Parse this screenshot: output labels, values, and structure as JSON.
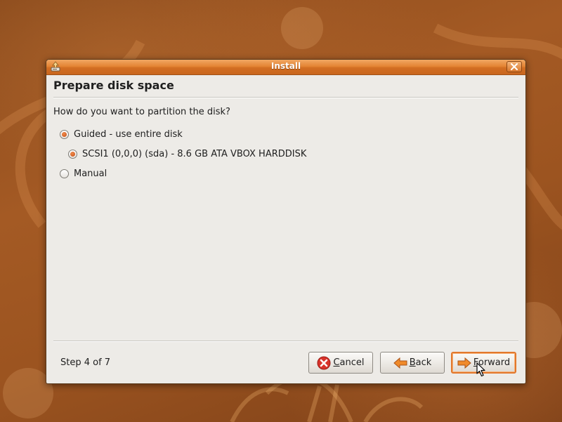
{
  "window": {
    "title": "Install"
  },
  "page": {
    "heading": "Prepare disk space",
    "question": "How do you want to partition the disk?"
  },
  "options": {
    "guided": {
      "label": "Guided - use entire disk",
      "checked": true
    },
    "disk": {
      "label": "SCSI1 (0,0,0) (sda) - 8.6 GB ATA VBOX HARDDISK",
      "checked": true
    },
    "manual": {
      "label": "Manual",
      "checked": false
    }
  },
  "footer": {
    "step": "Step 4 of 7",
    "cancel": {
      "mnemonic": "C",
      "rest": "ancel"
    },
    "back": {
      "mnemonic": "B",
      "rest": "ack"
    },
    "forward": {
      "mnemonic": "F",
      "rest": "orward"
    }
  },
  "colors": {
    "accent": "#e48434",
    "cancel_icon": "#d8322a",
    "arrow_icon": "#f08a2a"
  },
  "icons": {
    "app": "installer-icon",
    "close": "close-icon",
    "cancel": "cancel-icon",
    "back": "arrow-left-icon",
    "forward": "arrow-right-icon",
    "cursor": "mouse-pointer-icon"
  }
}
